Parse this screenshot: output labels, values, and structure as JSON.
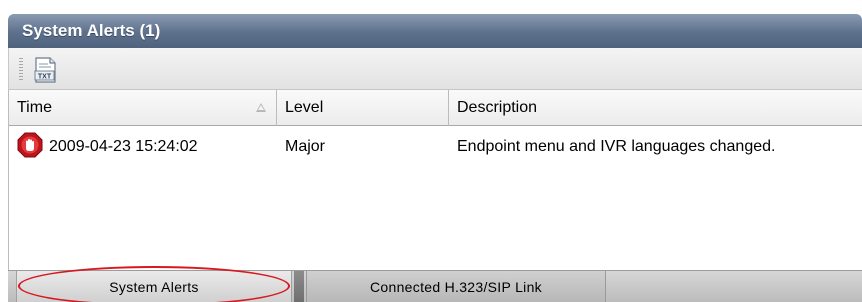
{
  "panel": {
    "title": "System Alerts (1)"
  },
  "toolbar": {
    "export_icon": "txt-file-icon",
    "export_icon_label": "TXT"
  },
  "table": {
    "columns": [
      {
        "label": "Time"
      },
      {
        "label": "Level"
      },
      {
        "label": "Description"
      }
    ],
    "sort_icon": "sort-ascending-icon",
    "rows": [
      {
        "severity_icon": "stop-hand-icon",
        "time": "2009-04-23 15:24:02",
        "level": "Major",
        "description": "Endpoint menu and IVR languages changed."
      }
    ]
  },
  "tabs": [
    {
      "label": "System Alerts",
      "selected": true
    },
    {
      "label": "Connected H.323/SIP Link",
      "selected": false
    }
  ],
  "colors": {
    "title_bar": "#5d708c",
    "severity_major": "#c0141c",
    "highlight": "#d8181f"
  }
}
